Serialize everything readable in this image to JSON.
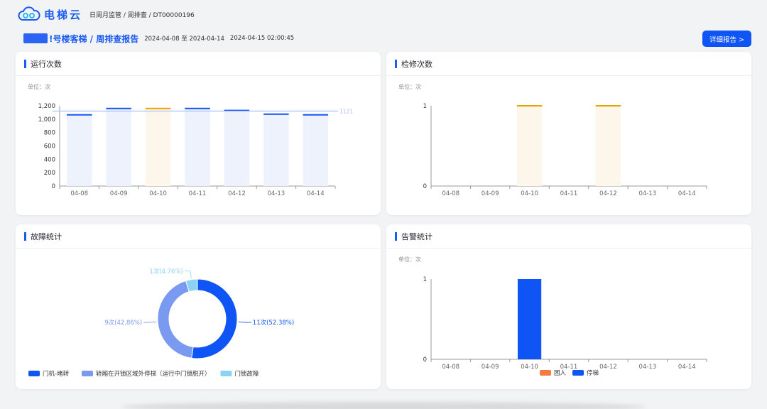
{
  "app": {
    "name": "电梯云"
  },
  "breadcrumb": "日周月监管 / 周排查 / DT00000196",
  "report": {
    "title": "!号楼客梯 / 周排查报告",
    "date_range": "2024-04-08 至 2024-04-14",
    "generated_at": "2024-04-15 02:00:45",
    "detail_button": "详细报告 >"
  },
  "colors": {
    "accent": "#0f54f5",
    "highlight": "#e8a400",
    "light_blue": "#7a9af2",
    "cyan": "#8ad3f5",
    "orange": "#f47c41"
  },
  "cards": {
    "run": {
      "title": "运行次数",
      "unit": "单位：次"
    },
    "maint": {
      "title": "检修次数",
      "unit": "单位：次"
    },
    "fault": {
      "title": "故障统计"
    },
    "alarm": {
      "title": "告警统计",
      "unit": "单位：次"
    }
  },
  "chart_data": [
    {
      "id": "run",
      "type": "bar",
      "categories": [
        "04-08",
        "04-09",
        "04-10",
        "04-11",
        "04-12",
        "04-13",
        "04-14"
      ],
      "values": [
        1065,
        1160,
        1160,
        1160,
        1130,
        1075,
        1065
      ],
      "highlight_index": 2,
      "avg_line": 1121,
      "avg_label": "1121",
      "ylim": [
        0,
        1200
      ],
      "yticks": [
        0,
        200,
        400,
        600,
        800,
        1000,
        1200
      ],
      "ytick_labels": [
        "0",
        "200",
        "400",
        "600",
        "800",
        "1,000",
        "1,200"
      ],
      "grid": false
    },
    {
      "id": "maint",
      "type": "bar",
      "categories": [
        "04-08",
        "04-09",
        "04-10",
        "04-11",
        "04-12",
        "04-13",
        "04-14"
      ],
      "values": [
        0,
        0,
        1,
        0,
        1,
        0,
        0
      ],
      "highlight_all": true,
      "ylim": [
        0,
        1
      ],
      "yticks": [
        0,
        1
      ],
      "ytick_labels": [
        "0",
        "1"
      ],
      "grid": false
    },
    {
      "id": "fault",
      "type": "pie",
      "style": "donut",
      "slices": [
        {
          "name": "门机-堵转",
          "value": 11,
          "percent": 52.38,
          "label": "11次(52.38%)",
          "color": "#0f54f5"
        },
        {
          "name": "轿厢在开锁区域外停梯（运行中门锁脱开）",
          "value": 9,
          "percent": 42.86,
          "label": "9次(42.86%)",
          "color": "#7a9af2"
        },
        {
          "name": "门锁故障",
          "value": 1,
          "percent": 4.76,
          "label": "1次(4.76%)",
          "color": "#8ad3f5"
        }
      ],
      "legend_position": "bottom-left"
    },
    {
      "id": "alarm",
      "type": "bar",
      "categories": [
        "04-08",
        "04-09",
        "04-10",
        "04-11",
        "04-12",
        "04-13",
        "04-14"
      ],
      "series": [
        {
          "name": "困人",
          "values": [
            0,
            0,
            0,
            0,
            0,
            0,
            0
          ],
          "color": "#f47c41"
        },
        {
          "name": "停梯",
          "values": [
            0,
            0,
            1,
            0,
            0,
            0,
            0
          ],
          "color": "#0f54f5"
        }
      ],
      "ylim": [
        0,
        1
      ],
      "yticks": [
        0,
        1
      ],
      "ytick_labels": [
        "0",
        "1"
      ],
      "legend_position": "bottom-center",
      "grid": false
    }
  ]
}
